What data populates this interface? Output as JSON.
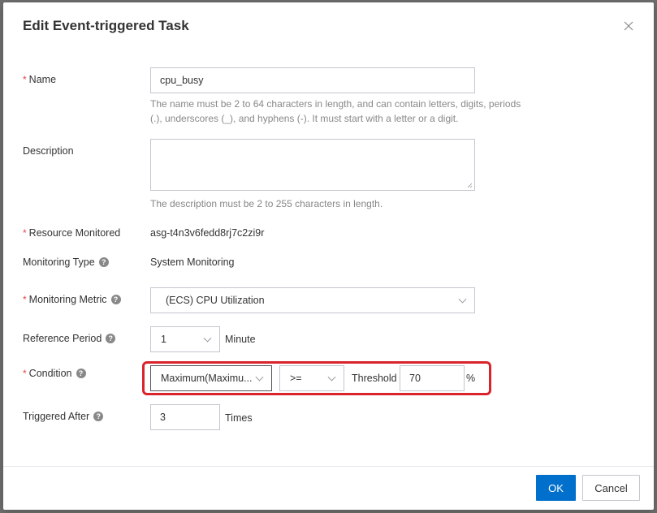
{
  "modal": {
    "title": "Edit Event-triggered Task",
    "required_mark": "*",
    "help_glyph": "?"
  },
  "name": {
    "label": "Name",
    "value": "cpu_busy",
    "hint_line1": "The name must be 2 to 64 characters in length, and can contain letters, digits, periods",
    "hint_line2": "(.), underscores (_), and hyphens (-). It must start with a letter or a digit."
  },
  "description": {
    "label": "Description",
    "value": "",
    "hint": "The description must be 2 to 255 characters in length."
  },
  "resource": {
    "label": "Resource Monitored",
    "value": "asg-t4n3v6fedd8rj7c2zi9r"
  },
  "monitoring_type": {
    "label": "Monitoring Type",
    "value": "System Monitoring"
  },
  "metric": {
    "label": "Monitoring Metric",
    "value": "(ECS)  CPU Utilization"
  },
  "reference_period": {
    "label": "Reference Period",
    "value": "1",
    "unit": "Minute"
  },
  "condition": {
    "label": "Condition",
    "statistic": "Maximum(Maximu...",
    "operator": ">=",
    "threshold_label": "Threshold",
    "threshold_value": "70",
    "unit": "%"
  },
  "triggered_after": {
    "label": "Triggered After",
    "value": "3",
    "unit": "Times"
  },
  "footer": {
    "ok_label": "OK",
    "cancel_label": "Cancel"
  },
  "colors": {
    "primary": "#0070cc",
    "required": "#e54545",
    "highlight": "#d9242c"
  }
}
